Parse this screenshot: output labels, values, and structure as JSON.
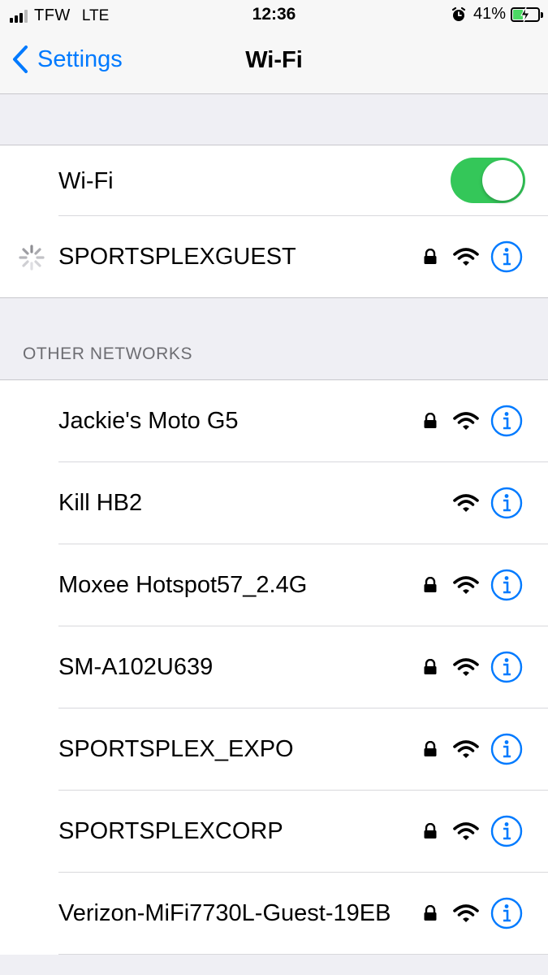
{
  "status_bar": {
    "carrier": "TFW",
    "network": "LTE",
    "time": "12:36",
    "battery_percent": "41%",
    "battery_level": 0.41,
    "signal_bars": 3,
    "signal_max": 4,
    "alarm_icon": "alarm-clock-icon",
    "charging": true
  },
  "nav": {
    "back_label": "Settings",
    "title": "Wi-Fi",
    "back_icon": "chevron-left-icon"
  },
  "colors": {
    "accent": "#007aff",
    "toggle_on": "#34c759",
    "battery_fill": "#4cd964"
  },
  "wifi_toggle": {
    "label": "Wi-Fi",
    "state": "on"
  },
  "current_network": {
    "name": "SPORTSPLEXGUEST",
    "connecting": true,
    "secured": true
  },
  "other_networks": {
    "header": "OTHER NETWORKS",
    "items": [
      {
        "name": "Jackie's Moto G5",
        "secured": true
      },
      {
        "name": "Kill HB2",
        "secured": false
      },
      {
        "name": "Moxee Hotspot57_2.4G",
        "secured": true
      },
      {
        "name": "SM-A102U639",
        "secured": true
      },
      {
        "name": "SPORTSPLEX_EXPO",
        "secured": true
      },
      {
        "name": "SPORTSPLEXCORP",
        "secured": true
      },
      {
        "name": "Verizon-MiFi7730L-Guest-19EB",
        "secured": true
      }
    ]
  }
}
